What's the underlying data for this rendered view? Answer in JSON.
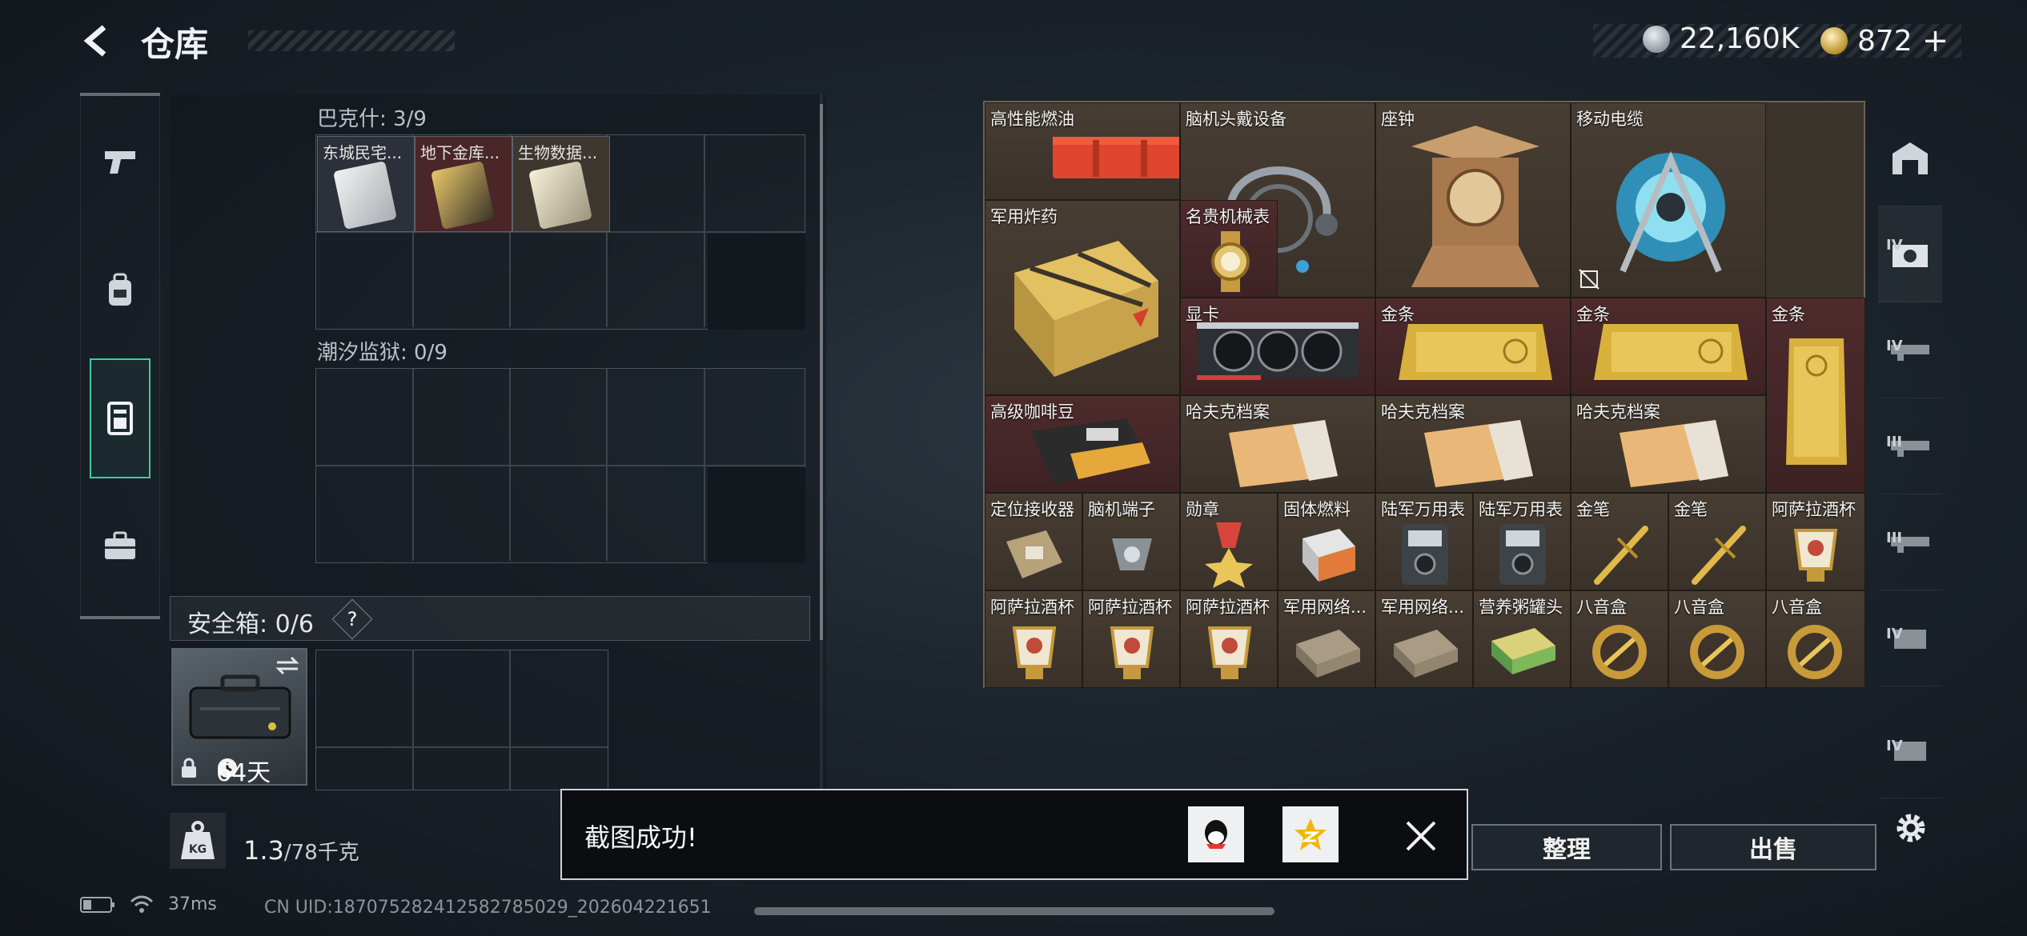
{
  "header": {
    "title": "仓库"
  },
  "currency": [
    {
      "name": "hafu-coin",
      "amount": "22,160K"
    },
    {
      "name": "gold-coin",
      "amount": "872",
      "suffix": "+"
    }
  ],
  "left_nav": [
    {
      "name": "weapons",
      "icon": "pistol-icon",
      "active": false
    },
    {
      "name": "gear",
      "icon": "backpack-icon",
      "active": false
    },
    {
      "name": "storage",
      "icon": "locker-icon",
      "active": true
    },
    {
      "name": "case",
      "icon": "briefcase-icon",
      "active": false
    }
  ],
  "sections": [
    {
      "label": "巴克什: 3/9",
      "items": [
        "东城民宅...",
        "地下金库...",
        "生物数据..."
      ]
    },
    {
      "label": "潮汐监狱: 0/9",
      "items": []
    }
  ],
  "safebox": {
    "label": "安全箱: 0/6",
    "help": "?",
    "days": "64天"
  },
  "weight": {
    "current": "1.3",
    "max": "/78千克",
    "unit_icon": "KG"
  },
  "inventory": [
    {
      "label": "高性能燃油",
      "bg": "dark"
    },
    {
      "label": "脑机头戴设备",
      "bg": "dark"
    },
    {
      "label": "座钟",
      "bg": "dark"
    },
    {
      "label": "移动电缆",
      "bg": "dark"
    },
    {
      "label": "军用炸药",
      "bg": "dark"
    },
    {
      "label": "名贵机械表",
      "bg": "red"
    },
    {
      "label": "显卡",
      "bg": "red"
    },
    {
      "label": "金条",
      "bg": "red"
    },
    {
      "label": "金条",
      "bg": "red"
    },
    {
      "label": "金条",
      "bg": "red"
    },
    {
      "label": "高级咖啡豆",
      "bg": "red"
    },
    {
      "label": "哈夫克档案",
      "bg": "dark"
    },
    {
      "label": "哈夫克档案",
      "bg": "dark"
    },
    {
      "label": "哈夫克档案",
      "bg": "dark"
    },
    {
      "label": "定位接收器",
      "bg": "dark"
    },
    {
      "label": "脑机端子",
      "bg": "dark"
    },
    {
      "label": "勋章",
      "bg": "dark"
    },
    {
      "label": "固体燃料",
      "bg": "dark"
    },
    {
      "label": "陆军万用表",
      "bg": "dark"
    },
    {
      "label": "陆军万用表",
      "bg": "dark"
    },
    {
      "label": "金笔",
      "bg": "dark"
    },
    {
      "label": "金笔",
      "bg": "dark"
    },
    {
      "label": "阿萨拉酒杯",
      "bg": "dark"
    },
    {
      "label": "阿萨拉酒杯",
      "bg": "dark"
    },
    {
      "label": "阿萨拉酒杯",
      "bg": "dark"
    },
    {
      "label": "阿萨拉酒杯",
      "bg": "dark"
    },
    {
      "label": "军用网络...",
      "bg": "dark"
    },
    {
      "label": "军用网络...",
      "bg": "dark"
    },
    {
      "label": "营养粥罐头",
      "bg": "dark"
    },
    {
      "label": "八音盒",
      "bg": "dark"
    },
    {
      "label": "八音盒",
      "bg": "dark"
    },
    {
      "label": "八音盒",
      "bg": "dark"
    }
  ],
  "right_toolbar": [
    {
      "name": "top",
      "tier": ""
    },
    {
      "name": "tier-iv-selected",
      "tier": "IV"
    },
    {
      "name": "tier-iv",
      "tier": "IV"
    },
    {
      "name": "tier-iii-a",
      "tier": "III"
    },
    {
      "name": "tier-iii-b",
      "tier": "III"
    },
    {
      "name": "tier-iv-b",
      "tier": "IV"
    },
    {
      "name": "tier-iv-c",
      "tier": "IV"
    }
  ],
  "buttons": {
    "sort": "整理",
    "sell": "出售"
  },
  "toast": {
    "text": "截图成功!"
  },
  "status": {
    "ping": "37ms",
    "uid": "CN UID:187075282412582785029_202604221651"
  }
}
